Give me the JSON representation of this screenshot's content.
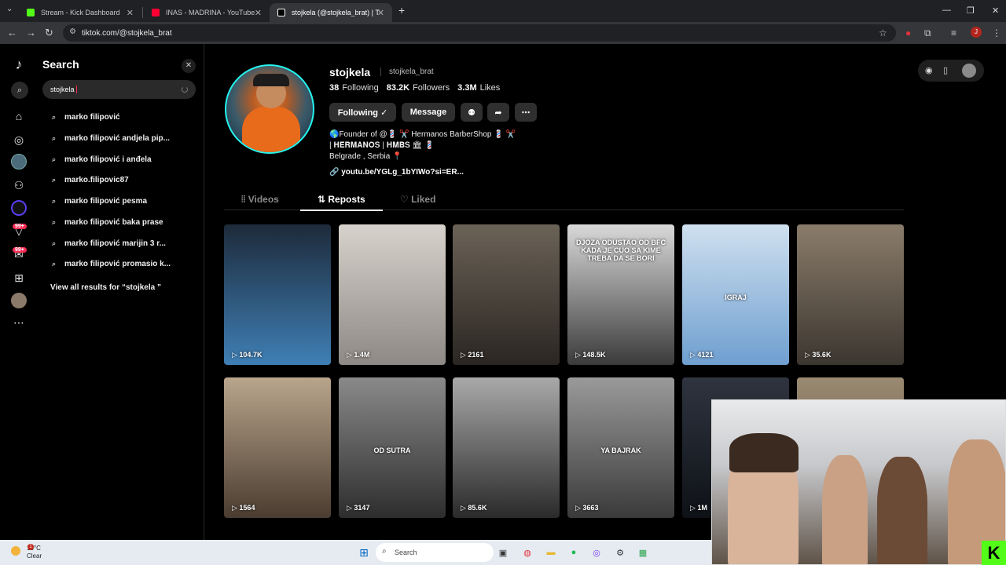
{
  "browser": {
    "tabs": [
      {
        "title": "Stream - Kick Dashboard",
        "favicon_color": "#53fc18"
      },
      {
        "title": "INAS - MADRINA - YouTube",
        "favicon_color": "#ff0033"
      },
      {
        "title": "stojkela (@stojkela_brat) | TikTo",
        "favicon_color": "#ffffff"
      }
    ],
    "new_tab_symbol": "+",
    "url": "tiktok.com/@stojkela_brat",
    "profile_initial": "J"
  },
  "search": {
    "title": "Search",
    "query": "stojkela",
    "suggestions": [
      "marko filipović",
      "marko filipović andjela pip...",
      "marko filipović i anđela",
      "marko.filipovic87",
      "marko filipović pesma",
      "marko filipović baka prase",
      "marko filipović marijin 3 r...",
      "marko filipović promasio k..."
    ],
    "view_all": "View all results for “stojkela ”"
  },
  "rail": {
    "badges": [
      "99+",
      "99+"
    ]
  },
  "profile": {
    "username": "stojkela",
    "handle": "stojkela_brat",
    "following_count": "38",
    "following_label": "Following",
    "followers_count": "83.2K",
    "followers_label": "Followers",
    "likes_count": "3.3M",
    "likes_label": "Likes",
    "following_button": "Following ✓",
    "message_button": "Message",
    "bio_lines": [
      "🌎Founder of @💈 ✂️ Hermanos BarberShop 💈 ✂️",
      "| 𝐇𝐄𝐑𝐌𝐀𝐍𝐎𝐒 | 𝐇𝐌𝐁𝐒 🏛 💈",
      "Belgrade , Serbia 📍"
    ],
    "link": "youtu.be/YGLg_1bYIWo?si=ER..."
  },
  "profile_tabs": {
    "videos": "Videos",
    "reposts": "Reposts",
    "liked": "Liked"
  },
  "videos": [
    {
      "views": "104.7K",
      "colors": [
        "#1d2a3a",
        "#3f7fb5"
      ],
      "overlay": ""
    },
    {
      "views": "1.4M",
      "colors": [
        "#d8d2cc",
        "#8e8985"
      ],
      "overlay": ""
    },
    {
      "views": "2161",
      "colors": [
        "#6b6257",
        "#2b2622"
      ],
      "overlay": ""
    },
    {
      "views": "148.5K",
      "colors": [
        "#d9d9d9",
        "#3b3b3b"
      ],
      "overlay": "DJOZA ODUSTAO OD BFC KADA JE CUO SA KIME TREBA DA SE BORI"
    },
    {
      "views": "4121",
      "colors": [
        "#cfe0ef",
        "#6f9fd0"
      ],
      "overlay": "IGRAJ"
    },
    {
      "views": "35.6K",
      "colors": [
        "#8a7c6a",
        "#3c3630"
      ],
      "overlay": ""
    },
    {
      "views": "1564",
      "colors": [
        "#b9a58c",
        "#4a3c30"
      ],
      "overlay": ""
    },
    {
      "views": "3147",
      "colors": [
        "#8a8a8a",
        "#2d2d2d"
      ],
      "overlay": "OD SUTRA"
    },
    {
      "views": "85.6K",
      "colors": [
        "#a9a9a9",
        "#2a2a2a"
      ],
      "overlay": ""
    },
    {
      "views": "3663",
      "colors": [
        "#9a9a9a",
        "#3a3a3a"
      ],
      "overlay": "YA BAJRAK"
    },
    {
      "views": "1M",
      "colors": [
        "#2f3440",
        "#0e1116"
      ],
      "overlay": ""
    },
    {
      "views": "",
      "colors": [
        "#9b8a72",
        "#5a4b3a"
      ],
      "overlay": ""
    }
  ],
  "taskbar": {
    "temperature": "16°C",
    "condition": "Clear",
    "search_placeholder": "Search",
    "notification_count": "1"
  },
  "overlay": {
    "kick_logo": "K"
  }
}
